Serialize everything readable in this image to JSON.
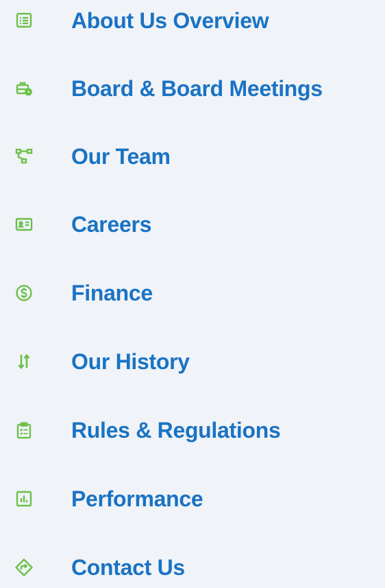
{
  "theme": {
    "background": "#f0f3f7",
    "icon_color": "#6cc04a",
    "link_color": "#1a73c4"
  },
  "nav": {
    "items": [
      {
        "label": "About Us Overview",
        "icon": "list-icon"
      },
      {
        "label": "Board & Board Meetings",
        "icon": "briefcase-clock-icon"
      },
      {
        "label": "Our Team",
        "icon": "org-chart-icon"
      },
      {
        "label": "Careers",
        "icon": "id-card-icon"
      },
      {
        "label": "Finance",
        "icon": "dollar-circle-icon"
      },
      {
        "label": "Our History",
        "icon": "sort-arrows-icon"
      },
      {
        "label": "Rules & Regulations",
        "icon": "clipboard-list-icon"
      },
      {
        "label": "Performance",
        "icon": "bar-chart-icon"
      },
      {
        "label": "Contact Us",
        "icon": "directions-icon"
      }
    ]
  }
}
